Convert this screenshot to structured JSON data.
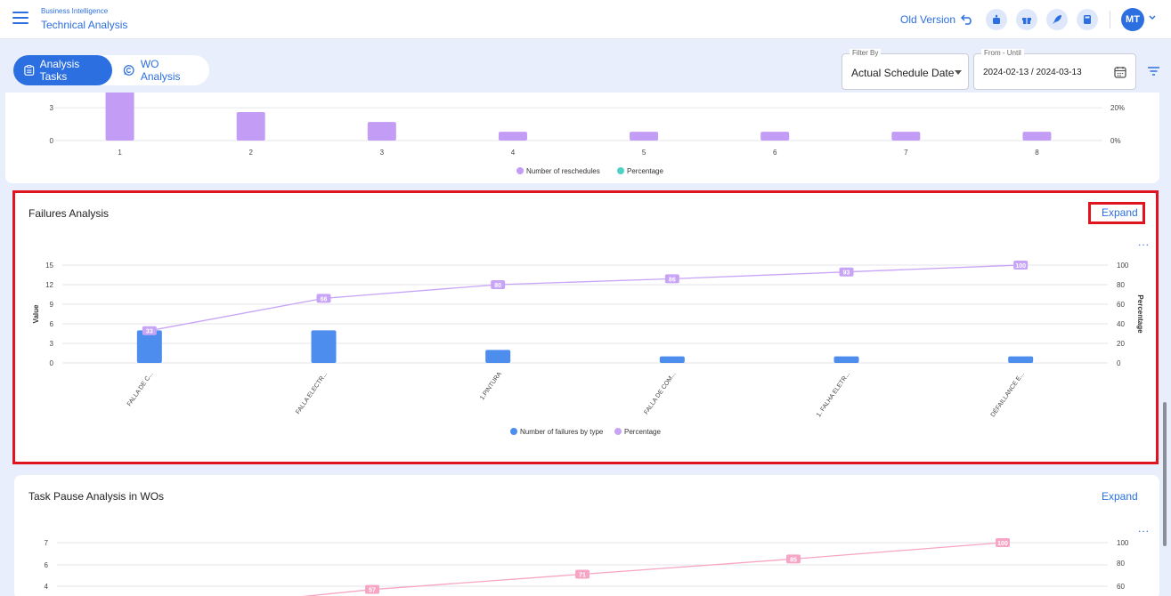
{
  "header": {
    "app_subtitle": "Business Intelligence",
    "app_title": "Technical Analysis",
    "old_version_label": "Old Version",
    "avatar_initials": "MT"
  },
  "tabs": [
    {
      "label": "Analysis Tasks",
      "active": true
    },
    {
      "label": "WO Analysis",
      "active": false
    }
  ],
  "filters": {
    "filter_by_label": "Filter By",
    "filter_by_value": "Actual Schedule Date",
    "date_label": "From - Until",
    "date_value": "2024-02-13 / 2024-03-13"
  },
  "colors": {
    "accent": "#2c6fe0",
    "bar_purple": "#c39cf5",
    "bar_blue": "#4c8dee",
    "line_purple": "#c7a4f6",
    "line_pink": "#f6a6c4",
    "highlight": "#e0141e"
  },
  "chart_data": [
    {
      "type": "bar",
      "title": "",
      "categories": [
        "1",
        "2",
        "3",
        "4",
        "5",
        "6",
        "7",
        "8"
      ],
      "series": [
        {
          "name": "Number of reschedules",
          "values": [
            4.5,
            2.6,
            1.7,
            0.8,
            0.8,
            0.8,
            0.8,
            0.8
          ]
        },
        {
          "name": "Percentage",
          "values": []
        }
      ],
      "y_ticks": [
        "0",
        "3"
      ],
      "y2_ticks": [
        "0%",
        "20%"
      ]
    },
    {
      "type": "bar",
      "title": "Failures Analysis",
      "categories": [
        "FALLA DE C...",
        "FALLA ELECTR...",
        "1.PINTURA",
        "FALLA DE COM...",
        "1. FALHA ELETR...",
        "DÉFAILLANCE E..."
      ],
      "series": [
        {
          "name": "Number of failures by type",
          "values": [
            5,
            5,
            2,
            1,
            1,
            1
          ]
        },
        {
          "name": "Percentage",
          "values": [
            33,
            66,
            80,
            86,
            93,
            100
          ]
        }
      ],
      "ylabel": "Value",
      "y2label": "Percentage",
      "ylim": [
        0,
        15
      ],
      "y2lim": [
        0,
        100
      ],
      "y_ticks": [
        "0",
        "3",
        "6",
        "9",
        "12",
        "15"
      ],
      "y2_ticks": [
        "0",
        "20",
        "40",
        "60",
        "80",
        "100"
      ]
    },
    {
      "type": "line",
      "title": "Task Pause Analysis in WOs",
      "series": [
        {
          "name": "Percentage",
          "values": [
            57,
            71,
            85,
            100
          ]
        }
      ],
      "y_ticks": [
        "4",
        "6",
        "7"
      ],
      "y2_ticks": [
        "60",
        "80",
        "100"
      ]
    }
  ],
  "cards": {
    "failures_title": "Failures Analysis",
    "task_pause_title": "Task Pause Analysis in WOs",
    "expand_label": "Expand",
    "more_label": "..."
  }
}
